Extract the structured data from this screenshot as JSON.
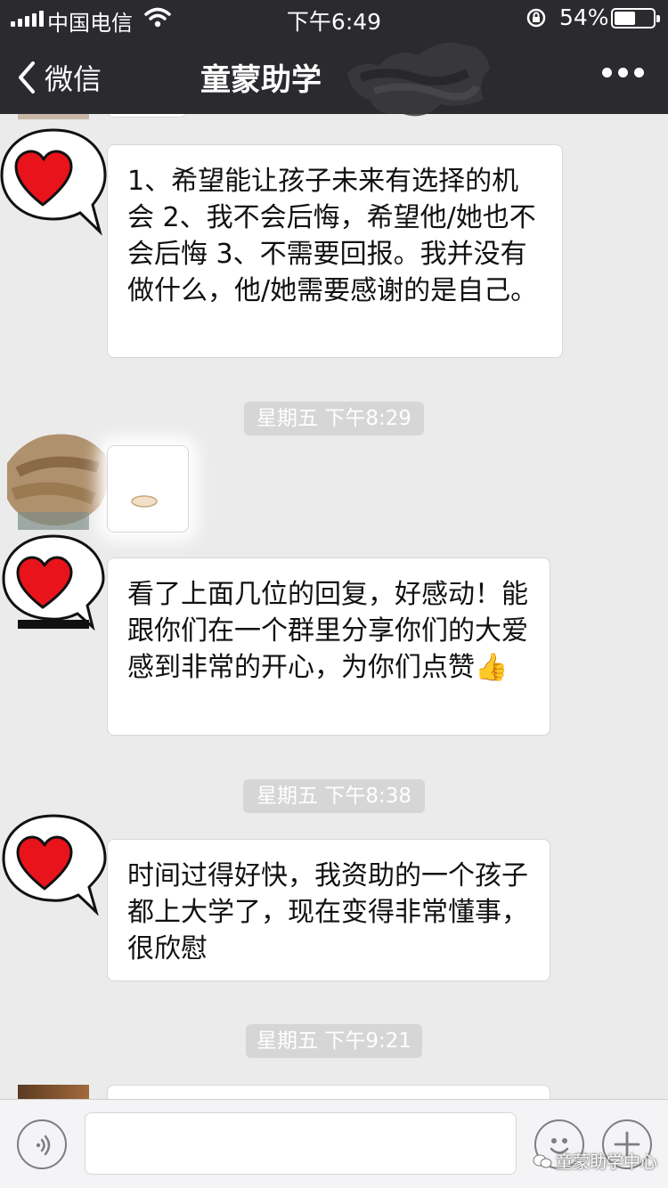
{
  "status": {
    "carrier": "中国电信",
    "time": "下午6:49",
    "battery_percent": "54%",
    "battery_level": 0.54,
    "icons": [
      "signal-icon",
      "wifi-icon",
      "orientation-lock-icon",
      "battery-icon"
    ]
  },
  "nav": {
    "back_label": "微信",
    "title": "童蒙助学",
    "icons": [
      "chevron-left-icon",
      "more-dots-icon"
    ]
  },
  "messages": [
    {
      "text": "1、希望能让孩子未来有选择的机会 2、我不会后悔，希望他/她也不会后悔 3、不需要回报。我并没有做什么，他/她需要感谢的是自己。"
    },
    {
      "text": "看了上面几位的回复，好感动！能跟你们在一个群里分享你们的大爱感到非常的开心，为你们点赞👍"
    },
    {
      "text": "时间过得好快，我资助的一个孩子都上大学了，现在变得非常懂事，很欣慰"
    }
  ],
  "timestamps": [
    "星期五 下午8:29",
    "星期五 下午8:38",
    "星期五 下午9:21"
  ],
  "input": {
    "value": "",
    "placeholder": "",
    "icons": [
      "voice-icon",
      "emoji-icon",
      "plus-icon"
    ]
  },
  "watermark": "童蒙助学中心",
  "colors": {
    "nav_bg": "#2b2b2f",
    "chat_bg": "#ebebeb",
    "heart": "#e8131b",
    "timestamp_bg": "#d6d6d6"
  }
}
